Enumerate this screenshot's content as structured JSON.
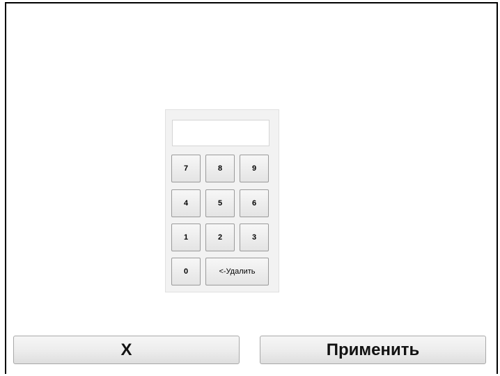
{
  "keypad": {
    "display_value": "",
    "keys": {
      "k7": "7",
      "k8": "8",
      "k9": "9",
      "k4": "4",
      "k5": "5",
      "k6": "6",
      "k1": "1",
      "k2": "2",
      "k3": "3",
      "k0": "0",
      "backspace": "<-Удалить"
    }
  },
  "actions": {
    "cancel_label": "X",
    "apply_label": "Применить"
  }
}
